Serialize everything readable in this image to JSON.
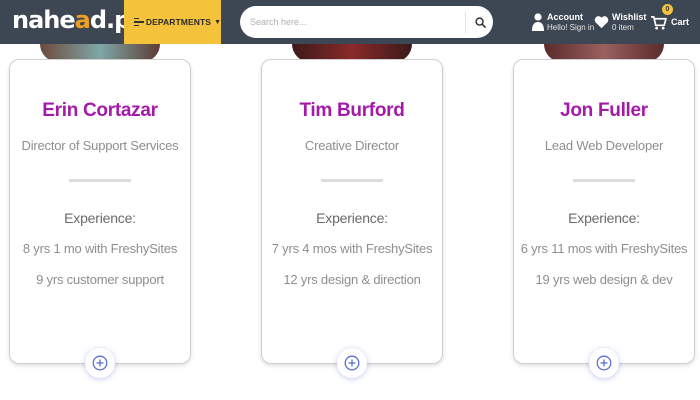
{
  "header": {
    "logo": {
      "part1": "nahe",
      "part2": "a",
      "part3": "d.pk"
    },
    "departments_label": "DEPARTMENTS",
    "search_placeholder": "Search here...",
    "account": {
      "title": "Account",
      "subtitle": "Hello! Sign in"
    },
    "wishlist": {
      "title": "Wishlist",
      "subtitle": "0 item"
    },
    "cart": {
      "label": "Cart",
      "count": "0"
    },
    "colors": {
      "bar": "#3d4653",
      "accent": "#f5c33b"
    }
  },
  "team": {
    "experience_heading": "Experience:",
    "members": [
      {
        "name": "Erin Cortazar",
        "role": "Director of Support Services",
        "line1": "8 yrs 1 mo with FreshySites",
        "line2": "9 yrs customer support"
      },
      {
        "name": "Tim Burford",
        "role": "Creative Director",
        "line1": "7 yrs 4 mos with FreshySites",
        "line2": "12 yrs design & direction"
      },
      {
        "name": "Jon Fuller",
        "role": "Lead Web Developer",
        "line1": "6 yrs 11 mos with FreshySites",
        "line2": "19 yrs web design & dev"
      }
    ],
    "colors": {
      "name": "#a51aa8",
      "text": "#8e8e8e"
    }
  }
}
